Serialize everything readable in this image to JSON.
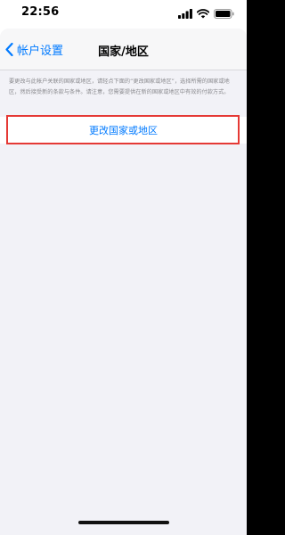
{
  "status_bar": {
    "time": "22:56",
    "icons": [
      "signal-icon",
      "wifi-icon",
      "battery-icon"
    ]
  },
  "nav": {
    "back_label": "帐户设置",
    "back_icon": "chevron-left-icon",
    "title": "国家/地区"
  },
  "content": {
    "description": "要更改与此帐户关联的国家或地区，请轻点下面的“更改国家或地区”，选择所需的国家或地区，然后接受新的条款与条件。请注意，您需要提供在新的国家或地区中有效的付款方式。",
    "change_region_label": "更改国家或地区"
  },
  "colors": {
    "accent": "#007aff",
    "background": "#f2f2f7",
    "highlight": "#e53935"
  }
}
